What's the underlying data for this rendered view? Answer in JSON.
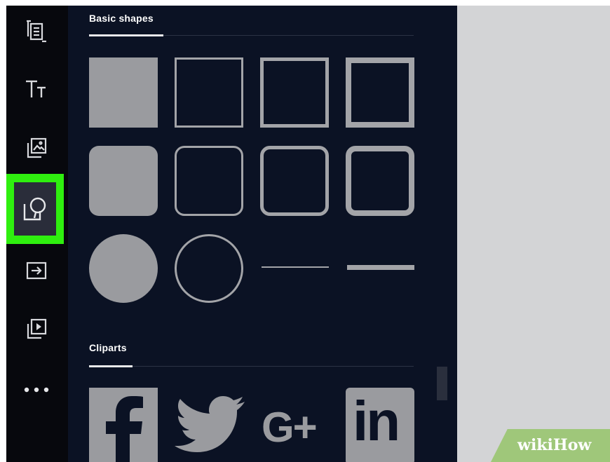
{
  "panel": {
    "basic_shapes_title": "Basic shapes",
    "cliparts_title": "Cliparts"
  },
  "rail": {
    "items": [
      {
        "icon": "text-list-icon"
      },
      {
        "icon": "text-size-icon"
      },
      {
        "icon": "image-stack-icon"
      },
      {
        "icon": "shapes-icon",
        "selected": true
      },
      {
        "icon": "import-arrow-icon"
      },
      {
        "icon": "video-stack-icon"
      },
      {
        "icon": "more-icon"
      }
    ]
  },
  "cliparts": {
    "items": [
      "facebook",
      "twitter",
      "google-plus",
      "linkedin"
    ],
    "google_plus_text": "G+",
    "linkedin_text": "in"
  },
  "watermark": {
    "part1": "wiki",
    "part2": "How"
  },
  "colors": {
    "rail_bg": "#07080d",
    "panel_bg": "#0b1224",
    "canvas_bg": "#d3d4d6",
    "shape_gray": "#9a9b9f",
    "highlight_green": "#2fef0f",
    "watermark_green": "#9fc77a"
  }
}
